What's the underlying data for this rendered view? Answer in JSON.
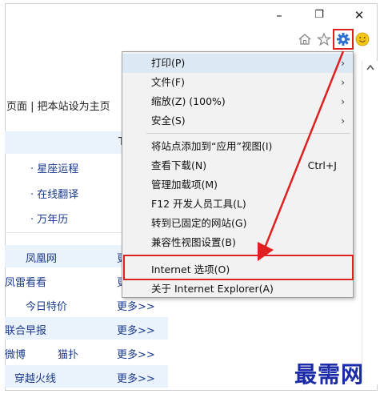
{
  "window_controls": {
    "minimize": "–",
    "restore": "❐",
    "close": "✕"
  },
  "toolbar": {
    "home_icon": "home-icon",
    "favorites_icon": "star-icon",
    "tools_icon": "gear-icon",
    "feedback_icon": "smiley-icon"
  },
  "page": {
    "homepage_link_partial": "页面 | 把本站设为主页",
    "tab_partial": "T",
    "links": [
      "· 星座运程",
      "· 在线翻译",
      "· 万年历"
    ],
    "list_rows": [
      {
        "name": "凤凰网",
        "more": "更"
      },
      {
        "name": "凤雷看看",
        "more": "更"
      },
      {
        "name": "今日特价",
        "more": "更多>>"
      },
      {
        "name": "联合早报",
        "more": "更多>>"
      },
      {
        "name": "微博",
        "extra": "猫扑",
        "more": "更多>>"
      },
      {
        "name": "穿越火线",
        "more": "更多>>"
      }
    ]
  },
  "menu": {
    "items": [
      {
        "label": "打印(P)",
        "submenu": true,
        "highlight": true
      },
      {
        "label": "文件(F)",
        "submenu": true
      },
      {
        "label": "缩放(Z) (100%)",
        "submenu": true
      },
      {
        "label": "安全(S)",
        "submenu": true
      },
      {
        "label": "将站点添加到“应用”视图(I)"
      },
      {
        "label": "查看下载(N)",
        "shortcut": "Ctrl+J"
      },
      {
        "label": "管理加载项(M)"
      },
      {
        "label": "F12 开发人员工具(L)"
      },
      {
        "label": "转到已固定的网站(G)"
      },
      {
        "label": "兼容性视图设置(B)"
      },
      {
        "label": "Internet 选项(O)"
      },
      {
        "label": "关于 Internet Explorer(A)"
      }
    ],
    "arrow_glyph": "›"
  },
  "watermark": "最需网",
  "colors": {
    "annotation_red": "#e02020",
    "watermark_blue": "#1a2aa8",
    "menu_bg": "#f2f2f2"
  }
}
